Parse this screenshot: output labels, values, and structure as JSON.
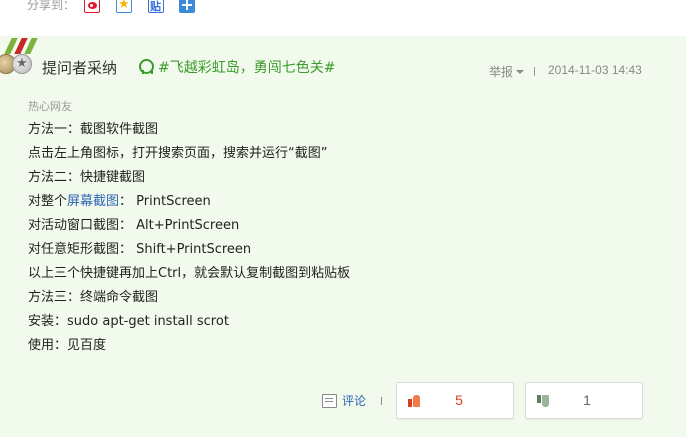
{
  "share": {
    "label": "分享到：",
    "icons": [
      "weibo-icon",
      "qzone-icon",
      "tieba-icon",
      "more-share-icon"
    ]
  },
  "answer": {
    "adopted_label": "提问者采纳",
    "topic": "#飞越彩虹岛，勇闯七色关#",
    "report_label": "举报",
    "date": "2014-11-03 14:43",
    "answerer": "热心网友",
    "lines": [
      "方法一：截图软件截图",
      "点击左上角图标，打开搜索页面，搜索并运行“截图”",
      "方法二：快捷键截图",
      "",
      "对活动窗口截图： Alt+PrintScreen",
      "对任意矩形截图： Shift+PrintScreen",
      "以上三个快捷键再加上Ctrl，就会默认复制截图到粘贴板",
      "方法三：终端命令截图",
      "安装：sudo apt-get install scrot",
      "使用：见百度"
    ],
    "line4_prefix": "对整个",
    "line4_link": "屏幕截图",
    "line4_suffix": "： PrintScreen"
  },
  "actions": {
    "comment_label": "评论",
    "upvotes": "5",
    "downvotes": "1"
  },
  "colors": {
    "panel_bg": "#f1faec",
    "topic_green": "#3a9b2a",
    "link_blue": "#2d64b3",
    "upvote_red": "#d9411e"
  }
}
